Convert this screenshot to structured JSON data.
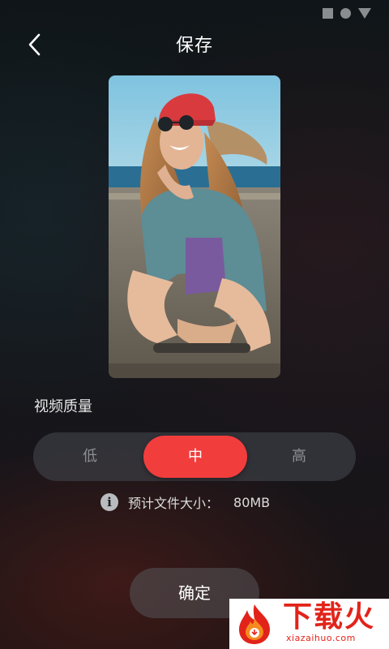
{
  "status_bar": {
    "icons": [
      "square-icon",
      "circle-icon",
      "triangle-icon"
    ]
  },
  "header": {
    "title": "保存",
    "back_icon": "chevron-left-icon"
  },
  "preview": {
    "description_free": true
  },
  "quality": {
    "label": "视频质量",
    "options": [
      "低",
      "中",
      "高"
    ],
    "selected": "中",
    "accent_color": "#f23d3d"
  },
  "file_size": {
    "icon": "info-icon",
    "icon_glyph": "i",
    "label": "预计文件大小：",
    "value": "80MB"
  },
  "confirm": {
    "label": "确定"
  },
  "watermark": {
    "brand": "下载火",
    "url": "xiazaihuo.com"
  }
}
